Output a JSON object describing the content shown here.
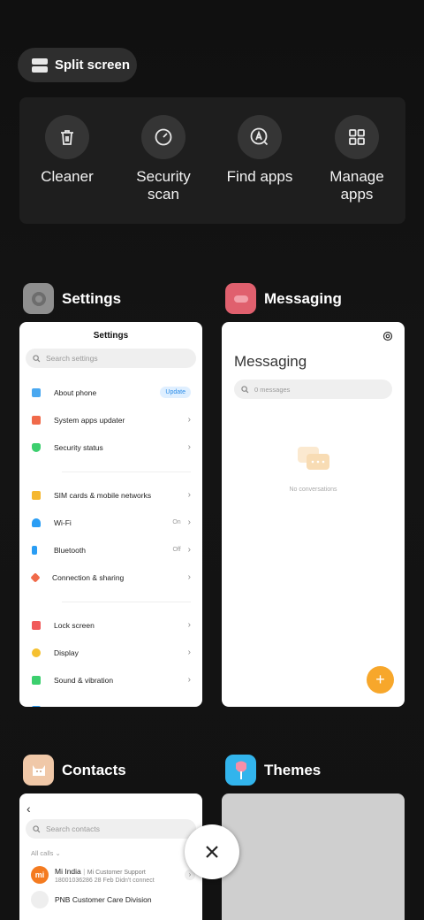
{
  "split_screen": {
    "label": "Split screen"
  },
  "tools": [
    {
      "label": "Cleaner",
      "icon": "trash-icon"
    },
    {
      "label": "Security\nscan",
      "line1": "Security",
      "line2": "scan",
      "icon": "gauge-icon"
    },
    {
      "label": "Find apps",
      "icon": "find-apps-icon"
    },
    {
      "label": "Manage\napps",
      "line1": "Manage",
      "line2": "apps",
      "icon": "grid-icon"
    }
  ],
  "apps": {
    "settings": {
      "name": "Settings",
      "title": "Settings",
      "search_placeholder": "Search settings",
      "items": [
        {
          "label": "About phone",
          "badge": "Update",
          "color": "#4aa8f0"
        },
        {
          "label": "System apps updater",
          "color": "#f06a4a"
        },
        {
          "label": "Security status",
          "color": "#3ccf6e"
        },
        {
          "label": "SIM cards & mobile networks",
          "color": "#f5b730"
        },
        {
          "label": "Wi-Fi",
          "value": "On",
          "color": "#2a9df4"
        },
        {
          "label": "Bluetooth",
          "value": "Off",
          "color": "#2a9df4"
        },
        {
          "label": "Connection & sharing",
          "color": "#f06a4a"
        },
        {
          "label": "Lock screen",
          "color": "#f05a5a"
        },
        {
          "label": "Display",
          "color": "#f5c030"
        },
        {
          "label": "Sound & vibration",
          "color": "#3ccf6e"
        }
      ]
    },
    "messaging": {
      "name": "Messaging",
      "title": "Messaging",
      "search_placeholder": "0 messages",
      "empty": "No conversations"
    },
    "contacts": {
      "name": "Contacts",
      "search_placeholder": "Search contacts",
      "filter": "All calls",
      "rows": [
        {
          "name": "Mi India",
          "sub1": "Mi Customer Support",
          "sub2": "18001036286  28 Feb Didn't connect"
        },
        {
          "name": "PNB Customer Care Division"
        }
      ]
    },
    "themes": {
      "name": "Themes"
    }
  },
  "colors": {
    "accent": "#f7a72b",
    "settings_icon": "#9a9a9a",
    "messaging_icon": "#e0606e",
    "contacts_icon": "#f0c8a8",
    "themes_icon": "#32b4ec"
  }
}
